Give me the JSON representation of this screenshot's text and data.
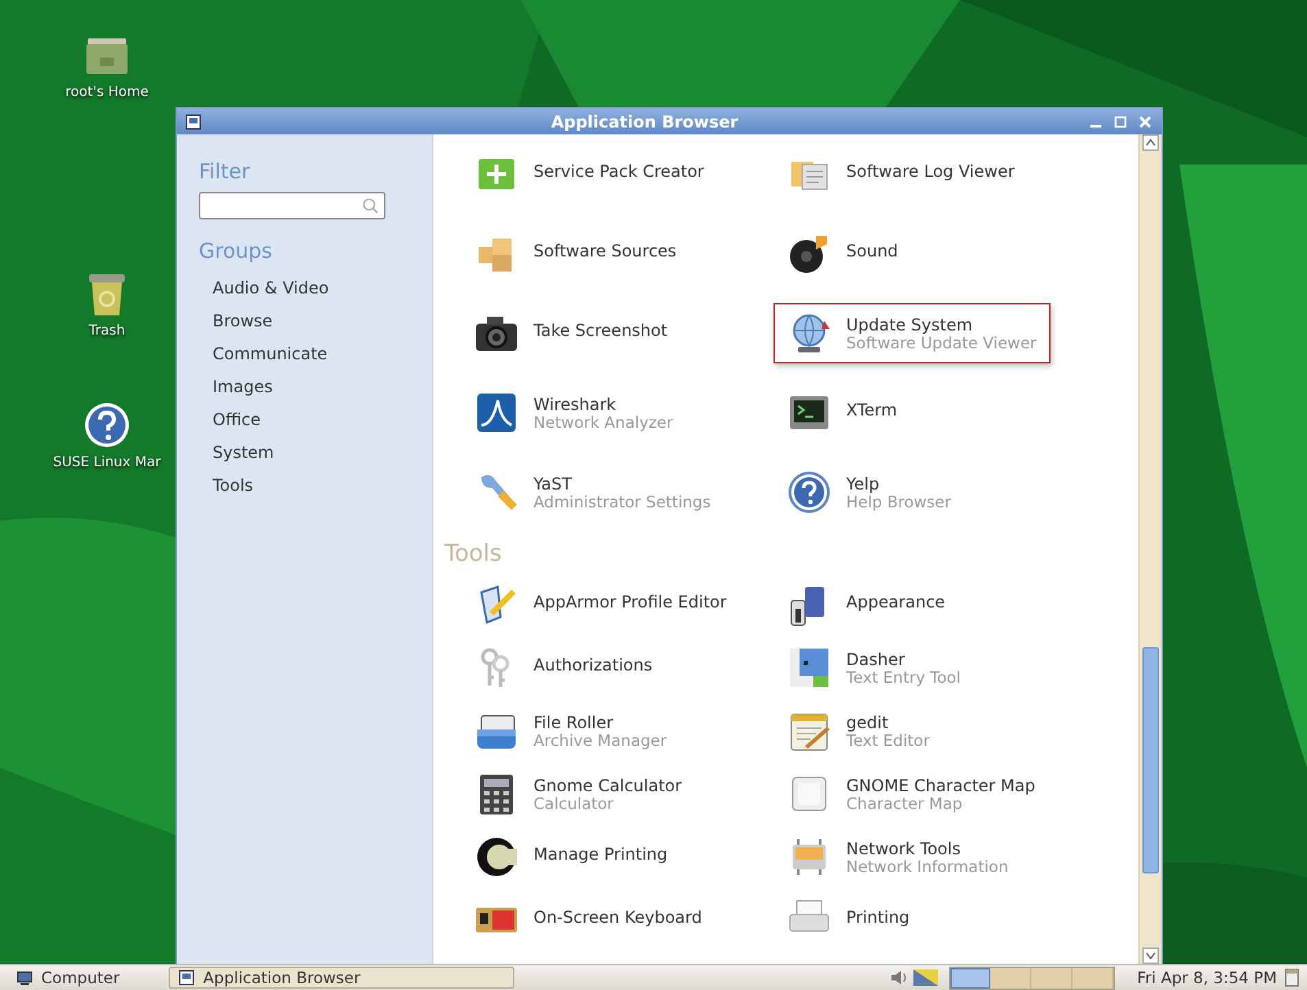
{
  "desktop_icons": [
    {
      "label": "root's Home",
      "kind": "folder"
    },
    {
      "label": "Trash",
      "kind": "trash"
    },
    {
      "label": "SUSE Linux Mar",
      "kind": "help"
    }
  ],
  "window": {
    "title": "Application Browser",
    "sidebar": {
      "filter_label": "Filter",
      "groups_label": "Groups",
      "groups": [
        {
          "label": "Audio & Video"
        },
        {
          "label": "Browse"
        },
        {
          "label": "Communicate"
        },
        {
          "label": "Images"
        },
        {
          "label": "Office"
        },
        {
          "label": "System"
        },
        {
          "label": "Tools"
        }
      ]
    },
    "sections": [
      {
        "apps": [
          {
            "name": "Service Pack Creator",
            "selected": false
          },
          {
            "name": "Software Log Viewer",
            "selected": false
          },
          {
            "name": "Software Sources",
            "selected": false
          },
          {
            "name": "Sound",
            "selected": false
          },
          {
            "name": "Take Screenshot",
            "selected": false
          },
          {
            "name": "Update System",
            "description": "Software Update Viewer",
            "selected": true
          },
          {
            "name": "Wireshark",
            "description": "Network Analyzer",
            "selected": false
          },
          {
            "name": "XTerm",
            "selected": false
          },
          {
            "name": "YaST",
            "description": "Administrator Settings",
            "selected": false
          },
          {
            "name": "Yelp",
            "description": "Help Browser",
            "selected": false
          }
        ]
      },
      {
        "heading": "Tools",
        "apps": [
          {
            "name": "AppArmor Profile Editor",
            "selected": false
          },
          {
            "name": "Appearance",
            "selected": false
          },
          {
            "name": "Authorizations",
            "selected": false
          },
          {
            "name": "Dasher",
            "description": "Text Entry Tool",
            "selected": false
          },
          {
            "name": "File Roller",
            "description": "Archive Manager",
            "selected": false
          },
          {
            "name": "gedit",
            "description": "Text Editor",
            "selected": false
          },
          {
            "name": "Gnome Calculator",
            "description": "Calculator",
            "selected": false
          },
          {
            "name": "GNOME Character Map",
            "description": "Character Map",
            "selected": false
          },
          {
            "name": "Manage Printing",
            "selected": false
          },
          {
            "name": "Network Tools",
            "description": "Network Information",
            "selected": false
          },
          {
            "name": "On-Screen Keyboard",
            "selected": false
          },
          {
            "name": "Printing",
            "selected": false
          }
        ]
      }
    ]
  },
  "taskbar": {
    "buttons": [
      {
        "label": "Computer",
        "kind": "menu"
      },
      {
        "label": "Application Browser",
        "kind": "window"
      }
    ],
    "workspaces": [
      {
        "selected": true
      },
      {
        "selected": false
      },
      {
        "selected": false
      },
      {
        "selected": false
      }
    ],
    "clock": "Fri Apr 8, 3:54 PM"
  }
}
